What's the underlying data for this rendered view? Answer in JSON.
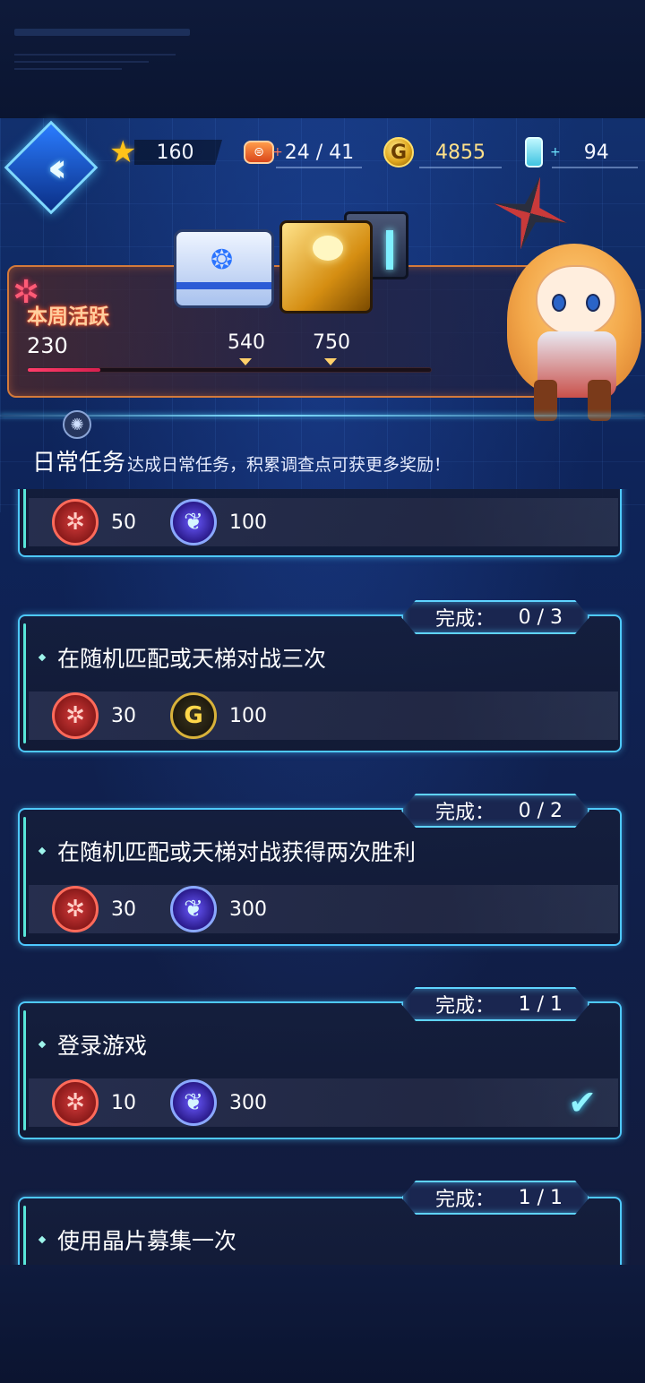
{
  "header": {
    "back_icon": "back-icon",
    "resources": {
      "stars": "160",
      "tickets": "24 / 41",
      "gold": "4855",
      "vials": "94"
    }
  },
  "weekly": {
    "title": "本周活跃",
    "current": "230",
    "milestones": [
      "540",
      "750"
    ],
    "progress_fraction": 0.18
  },
  "daily": {
    "title": "日常任务",
    "description": "达成日常任务，积累调查点可获更多奖励！"
  },
  "tasks": [
    {
      "name": "",
      "status_label": "",
      "status_value": "",
      "rewards": [
        {
          "icon": "activity-icon",
          "value": "50"
        },
        {
          "icon": "crystal-icon",
          "value": "100"
        }
      ],
      "completed": false
    },
    {
      "name": "在随机匹配或天梯对战三次",
      "status_label": "完成：",
      "status_value": "0 / 3",
      "rewards": [
        {
          "icon": "activity-icon",
          "value": "30"
        },
        {
          "icon": "gold-coin-icon",
          "value": "100"
        }
      ],
      "completed": false
    },
    {
      "name": "在随机匹配或天梯对战获得两次胜利",
      "status_label": "完成：",
      "status_value": "0 / 2",
      "rewards": [
        {
          "icon": "activity-icon",
          "value": "30"
        },
        {
          "icon": "crystal-icon",
          "value": "300"
        }
      ],
      "completed": false
    },
    {
      "name": "登录游戏",
      "status_label": "完成：",
      "status_value": "1 / 1",
      "rewards": [
        {
          "icon": "activity-icon",
          "value": "10"
        },
        {
          "icon": "crystal-icon",
          "value": "300"
        }
      ],
      "completed": true
    },
    {
      "name": "使用晶片募集一次",
      "status_label": "完成：",
      "status_value": "1 / 1",
      "rewards": [],
      "completed": true
    }
  ],
  "colors": {
    "accent_cyan": "#4ec9ff",
    "weekly_border": "#d47a3a",
    "progress_fill": "#ff3d6a"
  }
}
